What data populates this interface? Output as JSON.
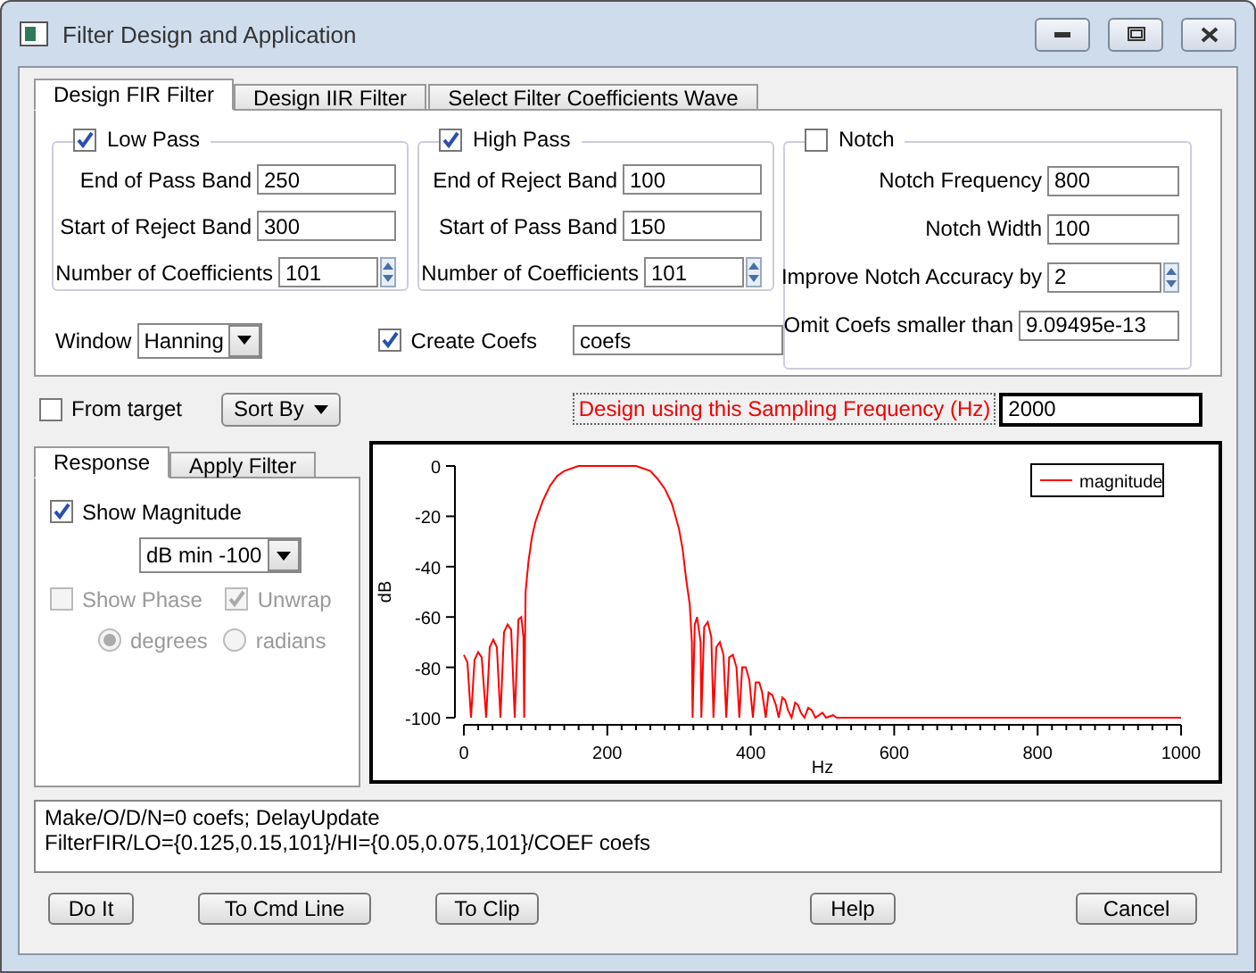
{
  "window": {
    "title": "Filter Design and Application"
  },
  "tabs": [
    {
      "label": "Design FIR Filter",
      "selected": true
    },
    {
      "label": "Design IIR Filter",
      "selected": false
    },
    {
      "label": "Select Filter Coefficients Wave",
      "selected": false
    }
  ],
  "groups": [
    {
      "label": "Low Pass",
      "checked": true,
      "fields": [
        {
          "label": "End of Pass Band",
          "value": "250",
          "kind": "text"
        },
        {
          "label": "Start of Reject Band",
          "value": "300",
          "kind": "text"
        },
        {
          "label": "Number of Coefficients",
          "value": "101",
          "kind": "spin"
        }
      ]
    },
    {
      "label": "High Pass",
      "checked": true,
      "fields": [
        {
          "label": "End of Reject Band",
          "value": "100",
          "kind": "text"
        },
        {
          "label": "Start of Pass Band",
          "value": "150",
          "kind": "text"
        },
        {
          "label": "Number of Coefficients",
          "value": "101",
          "kind": "spin"
        }
      ]
    },
    {
      "label": "Notch",
      "checked": false,
      "fields": [
        {
          "label": "Notch Frequency",
          "value": "800",
          "kind": "text"
        },
        {
          "label": "Notch Width",
          "value": "100",
          "kind": "text"
        },
        {
          "label": "Improve Notch Accuracy by",
          "value": "2",
          "kind": "spin"
        },
        {
          "label": "Omit Coefs smaller than",
          "value": "9.09495e-13",
          "kind": "text"
        }
      ]
    }
  ],
  "window_select": {
    "label": "Window",
    "value": "Hanning"
  },
  "create_coefs": {
    "label": "Create Coefs",
    "checked": true,
    "value": "coefs"
  },
  "from_target": {
    "label": "From target",
    "checked": false
  },
  "sort_by": {
    "label": "Sort By"
  },
  "sampling": {
    "label": "Design using this Sampling Frequency (Hz)",
    "value": "2000"
  },
  "response_tabs": [
    {
      "label": "Response",
      "selected": true
    },
    {
      "label": "Apply Filter",
      "selected": false
    }
  ],
  "show_magnitude": {
    "label": "Show Magnitude",
    "checked": true
  },
  "db_min": {
    "value": "dB min -100"
  },
  "show_phase": {
    "label": "Show Phase",
    "checked": false,
    "disabled": true
  },
  "unwrap": {
    "label": "Unwrap",
    "checked": true,
    "disabled": true
  },
  "units": [
    {
      "label": "degrees",
      "selected": true,
      "disabled": true
    },
    {
      "label": "radians",
      "selected": false,
      "disabled": true
    }
  ],
  "chart": {
    "chart_data": {
      "type": "line",
      "xlabel": "Hz",
      "ylabel": "dB",
      "xlim": [
        0,
        1000
      ],
      "ylim": [
        -100,
        0
      ],
      "xticks": [
        0,
        200,
        400,
        600,
        800,
        1000
      ],
      "yticks": [
        0,
        -20,
        -40,
        -60,
        -80,
        -100
      ],
      "x": [
        0,
        5,
        10,
        15,
        20,
        25,
        31,
        36,
        41,
        46,
        51,
        56,
        61,
        66,
        71,
        76,
        80,
        83,
        84,
        86,
        90,
        95,
        100,
        110,
        120,
        130,
        140,
        150,
        160,
        240,
        250,
        260,
        270,
        280,
        290,
        300,
        305,
        310,
        315,
        318,
        319,
        322,
        325,
        330,
        331,
        335,
        340,
        345,
        348,
        352,
        357,
        362,
        366,
        370,
        375,
        380,
        384,
        388,
        393,
        398,
        403,
        407,
        412,
        416,
        421,
        425,
        430,
        435,
        439,
        444,
        448,
        452,
        457,
        462,
        466,
        470,
        475,
        480,
        485,
        490,
        500,
        505,
        515,
        520,
        1000
      ],
      "series": [
        {
          "name": "magnitude",
          "color": "#ff0000",
          "values": [
            -75,
            -78,
            -100,
            -77,
            -74,
            -76,
            -100,
            -72,
            -69,
            -72,
            -100,
            -66,
            -63,
            -65,
            -100,
            -61,
            -60,
            -68,
            -100,
            -50,
            -38,
            -28,
            -22,
            -14,
            -8,
            -4,
            -2,
            -1,
            0,
            0,
            -1,
            -2,
            -5,
            -9,
            -15,
            -25,
            -33,
            -45,
            -55,
            -70,
            -100,
            -63,
            -60,
            -70,
            -100,
            -64,
            -62,
            -68,
            -100,
            -72,
            -70,
            -75,
            -100,
            -76,
            -75,
            -80,
            -100,
            -80,
            -80,
            -85,
            -100,
            -86,
            -86,
            -90,
            -100,
            -90,
            -91,
            -95,
            -100,
            -92,
            -93,
            -97,
            -100,
            -94,
            -95,
            -98,
            -100,
            -96,
            -97,
            -100,
            -98,
            -100,
            -99,
            -100,
            -100
          ]
        }
      ]
    }
  },
  "command": [
    "Make/O/D/N=0 coefs; DelayUpdate",
    "FilterFIR/LO={0.125,0.15,101}/HI={0.05,0.075,101}/COEF coefs"
  ],
  "buttons": [
    "Do It",
    "To Cmd Line",
    "To Clip",
    "Help",
    "Cancel"
  ]
}
